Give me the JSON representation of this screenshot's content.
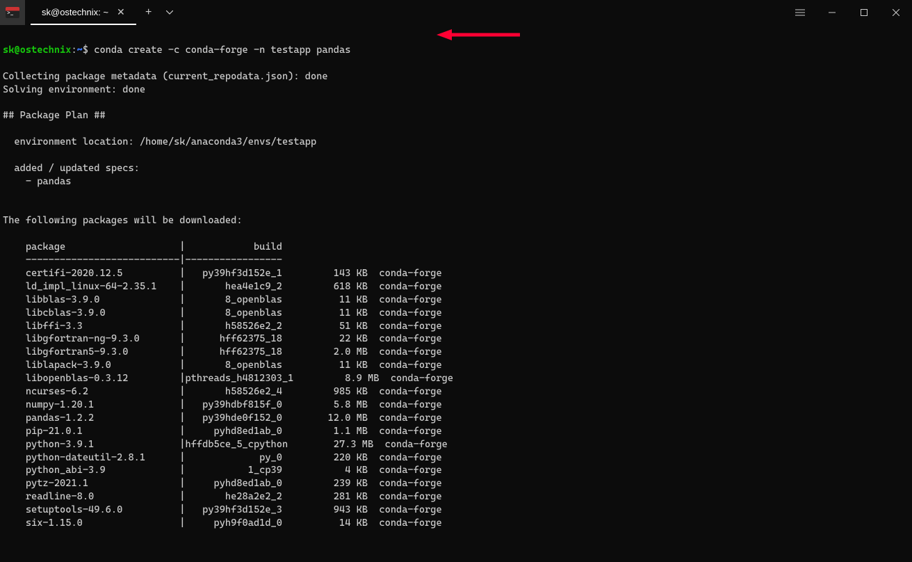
{
  "tab_title": "sk@ostechnix: ~",
  "prompt": {
    "user": "sk@ostechnix",
    "path": "~",
    "command": "conda create -c conda-forge -n testapp pandas"
  },
  "output_lines": [
    "Collecting package metadata (current_repodata.json): done",
    "Solving environment: done",
    "",
    "## Package Plan ##",
    "",
    "  environment location: /home/sk/anaconda3/envs/testapp",
    "",
    "  added / updated specs:",
    "    - pandas",
    "",
    "",
    "The following packages will be downloaded:",
    "",
    "    package                    |            build",
    "    ---------------------------|-----------------",
    "    certifi-2020.12.5          |   py39hf3d152e_1         143 KB  conda-forge",
    "    ld_impl_linux-64-2.35.1    |       hea4e1c9_2         618 KB  conda-forge",
    "    libblas-3.9.0              |       8_openblas          11 KB  conda-forge",
    "    libcblas-3.9.0             |       8_openblas          11 KB  conda-forge",
    "    libffi-3.3                 |       h58526e2_2          51 KB  conda-forge",
    "    libgfortran-ng-9.3.0       |      hff62375_18          22 KB  conda-forge",
    "    libgfortran5-9.3.0         |      hff62375_18         2.0 MB  conda-forge",
    "    liblapack-3.9.0            |       8_openblas          11 KB  conda-forge",
    "    libopenblas-0.3.12         |pthreads_h4812303_1         8.9 MB  conda-forge",
    "    ncurses-6.2                |       h58526e2_4         985 KB  conda-forge",
    "    numpy-1.20.1               |   py39hdbf815f_0         5.8 MB  conda-forge",
    "    pandas-1.2.2               |   py39hde0f152_0        12.0 MB  conda-forge",
    "    pip-21.0.1                 |     pyhd8ed1ab_0         1.1 MB  conda-forge",
    "    python-3.9.1               |hffdb5ce_5_cpython        27.3 MB  conda-forge",
    "    python-dateutil-2.8.1      |             py_0         220 KB  conda-forge",
    "    python_abi-3.9             |           1_cp39           4 KB  conda-forge",
    "    pytz-2021.1                |     pyhd8ed1ab_0         239 KB  conda-forge",
    "    readline-8.0               |       he28a2e2_2         281 KB  conda-forge",
    "    setuptools-49.6.0          |   py39hf3d152e_3         943 KB  conda-forge",
    "    six-1.15.0                 |     pyh9f0ad1d_0          14 KB  conda-forge"
  ]
}
